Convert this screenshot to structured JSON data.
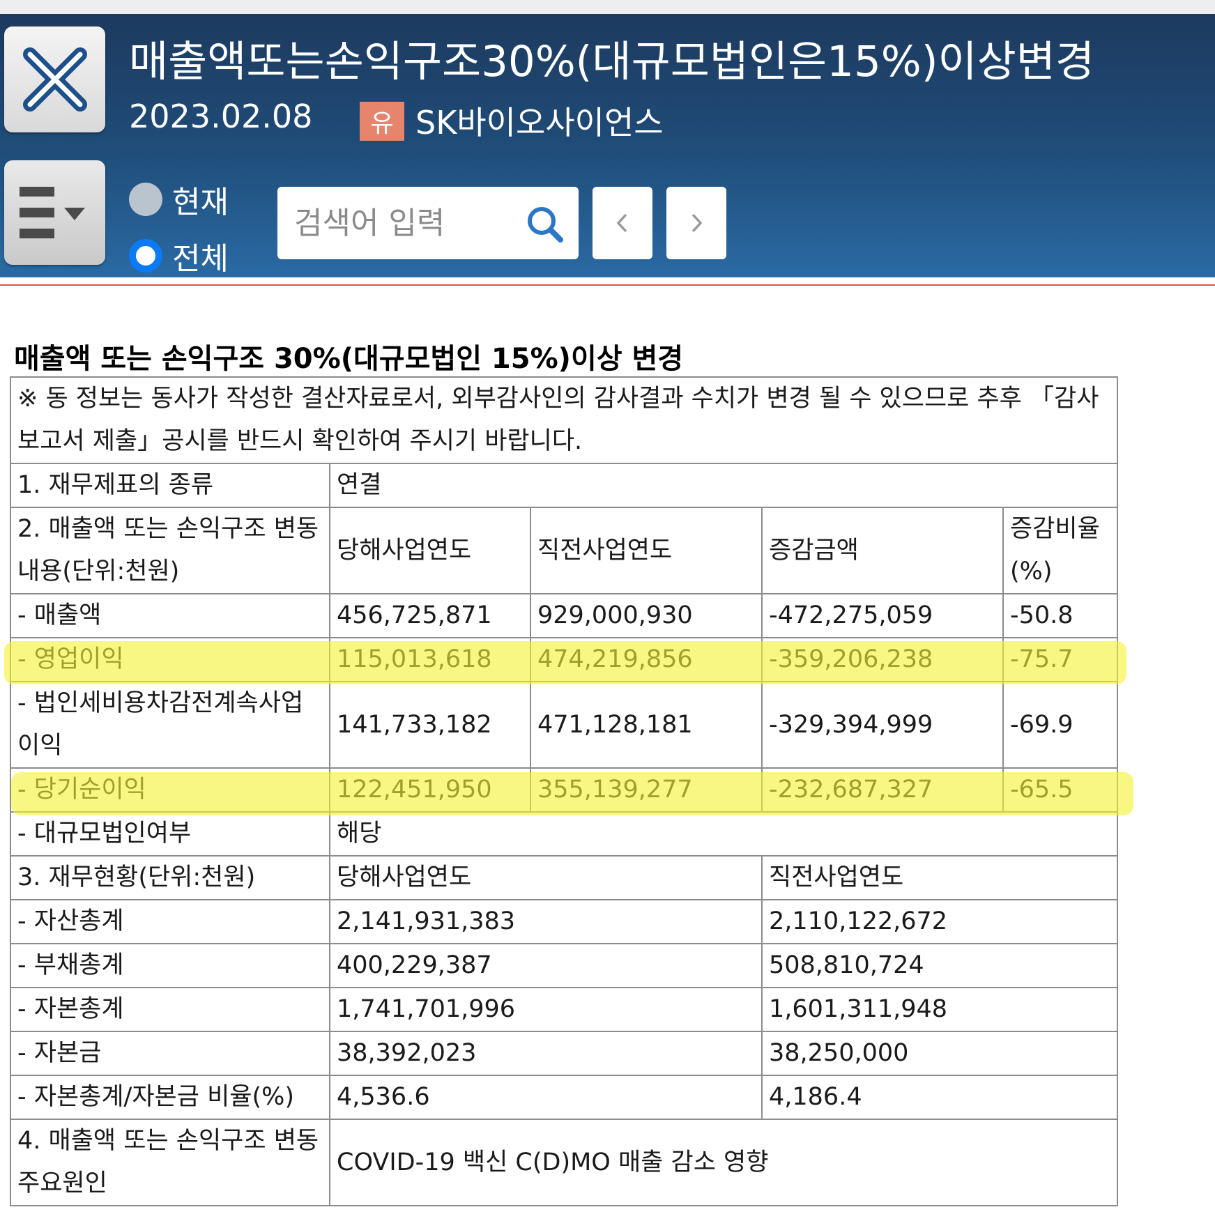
{
  "header": {
    "title": "매출액또는손익구조30%(대규모법인은15%)이상변경",
    "date": "2023.02.08",
    "market_badge": "유",
    "company": "SK바이오사이언스",
    "radio_current": "현재",
    "radio_all": "전체",
    "selected_scope": "전체",
    "search_placeholder": "검색어 입력",
    "colors": {
      "header_bg": "#1f4c78",
      "badge": "#e7846c",
      "radio_selected": "#0a7bf5",
      "highlight": "#f3f234"
    }
  },
  "doc": {
    "title": "매출액 또는 손익구조 30%(대규모법인 15%)이상 변경",
    "notice": "※ 동 정보는 동사가 작성한 결산자료로서, 외부감사인의 감사결과 수치가 변경 될 수 있으므로 추후 「감사보고서 제출」공시를 반드시 확인하여 주시기 바랍니다.",
    "item1_label": "1. 재무제표의 종류",
    "item1_value": "연결",
    "item2_label": "2. 매출액 또는 손익구조 변동내용(단위:천원)",
    "item2_columns": [
      "당해사업연도",
      "직전사업연도",
      "증감금액",
      "증감비율(%)"
    ],
    "item2_rows": [
      {
        "label": "- 매출액",
        "current": "456,725,871",
        "previous": "929,000,930",
        "change": "-472,275,059",
        "ratio": "-50.8"
      },
      {
        "label": "- 영업이익",
        "current": "115,013,618",
        "previous": "474,219,856",
        "change": "-359,206,238",
        "ratio": "-75.7"
      },
      {
        "label": "- 법인세비용차감전계속사업이익",
        "current": "141,733,182",
        "previous": "471,128,181",
        "change": "-329,394,999",
        "ratio": "-69.9"
      },
      {
        "label": "- 당기순이익",
        "current": "122,451,950",
        "previous": "355,139,277",
        "change": "-232,687,327",
        "ratio": "-65.5"
      }
    ],
    "large_corp_label": "- 대규모법인여부",
    "large_corp_value": "해당",
    "item3_label": "3. 재무현황(단위:천원)",
    "item3_columns": [
      "당해사업연도",
      "직전사업연도"
    ],
    "item3_rows": [
      {
        "label": "- 자산총계",
        "current": "2,141,931,383",
        "previous": "2,110,122,672"
      },
      {
        "label": "- 부채총계",
        "current": "400,229,387",
        "previous": "508,810,724"
      },
      {
        "label": "- 자본총계",
        "current": "1,741,701,996",
        "previous": "1,601,311,948"
      },
      {
        "label": "- 자본금",
        "current": "38,392,023",
        "previous": "38,250,000"
      },
      {
        "label": "- 자본총계/자본금 비율(%)",
        "current": "4,536.6",
        "previous": "4,186.4"
      }
    ],
    "item4_label": "4. 매출액 또는 손익구조 변동 주요원인",
    "item4_value": "COVID-19 백신 C(D)MO 매출 감소 영향"
  }
}
